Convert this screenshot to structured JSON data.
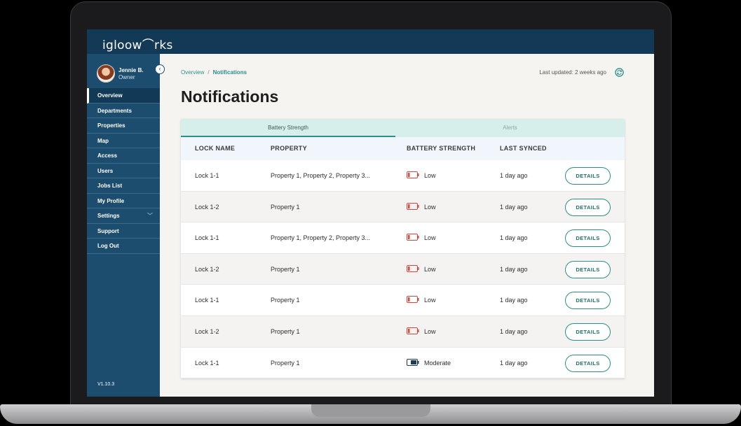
{
  "app": {
    "logo_text": "igloow⌒rks"
  },
  "user": {
    "name": "Jennie B.",
    "role": "Owner"
  },
  "sidebar": {
    "items": [
      {
        "label": "Overview",
        "active": true
      },
      {
        "label": "Departments"
      },
      {
        "label": "Properties"
      },
      {
        "label": "Map"
      },
      {
        "label": "Access"
      },
      {
        "label": "Users"
      },
      {
        "label": "Jobs List"
      },
      {
        "label": "My Profile"
      },
      {
        "label": "Settings",
        "has_submenu": true
      },
      {
        "label": "Support"
      },
      {
        "label": "Log Out"
      }
    ],
    "version": "V1.10.3"
  },
  "breadcrumb": {
    "root": "Overview",
    "separator": "/",
    "current": "Notifications"
  },
  "header": {
    "last_updated_label": "Last updated:",
    "last_updated_value": "2 weeks ago"
  },
  "page": {
    "title": "Notifications"
  },
  "tabs": [
    {
      "label": "Battery Strength",
      "selected": true
    },
    {
      "label": "Alerts",
      "selected": false
    }
  ],
  "table": {
    "columns": [
      "LOCK NAME",
      "PROPERTY",
      "BATTERY STRENGTH",
      "LAST SYNCED"
    ],
    "action_label": "DETAILS",
    "rows": [
      {
        "lock": "Lock 1-1",
        "property": "Property 1, Property 2, Property 3...",
        "battery": "Low",
        "synced": "1 day ago"
      },
      {
        "lock": "Lock 1-2",
        "property": "Property 1",
        "battery": "Low",
        "synced": "1 day ago"
      },
      {
        "lock": "Lock 1-1",
        "property": "Property 1, Property 2, Property 3...",
        "battery": "Low",
        "synced": "1 day ago"
      },
      {
        "lock": "Lock 1-2",
        "property": "Property 1",
        "battery": "Low",
        "synced": "1 day ago"
      },
      {
        "lock": "Lock 1-1",
        "property": "Property 1",
        "battery": "Low",
        "synced": "1 day ago"
      },
      {
        "lock": "Lock 1-2",
        "property": "Property 1",
        "battery": "Low",
        "synced": "1 day ago"
      },
      {
        "lock": "Lock 1-1",
        "property": "Property 1",
        "battery": "Moderate",
        "synced": "1 day ago"
      }
    ]
  },
  "colors": {
    "topbar": "#123a57",
    "sidebar": "#1c4d6e",
    "accent_teal": "#2a8f88",
    "battery_low": "#d9453a",
    "battery_moderate": "#1c3a57"
  },
  "icons": {
    "refresh": "refresh-icon",
    "collapse": "chevron-left-icon",
    "battery": "battery-icon"
  }
}
